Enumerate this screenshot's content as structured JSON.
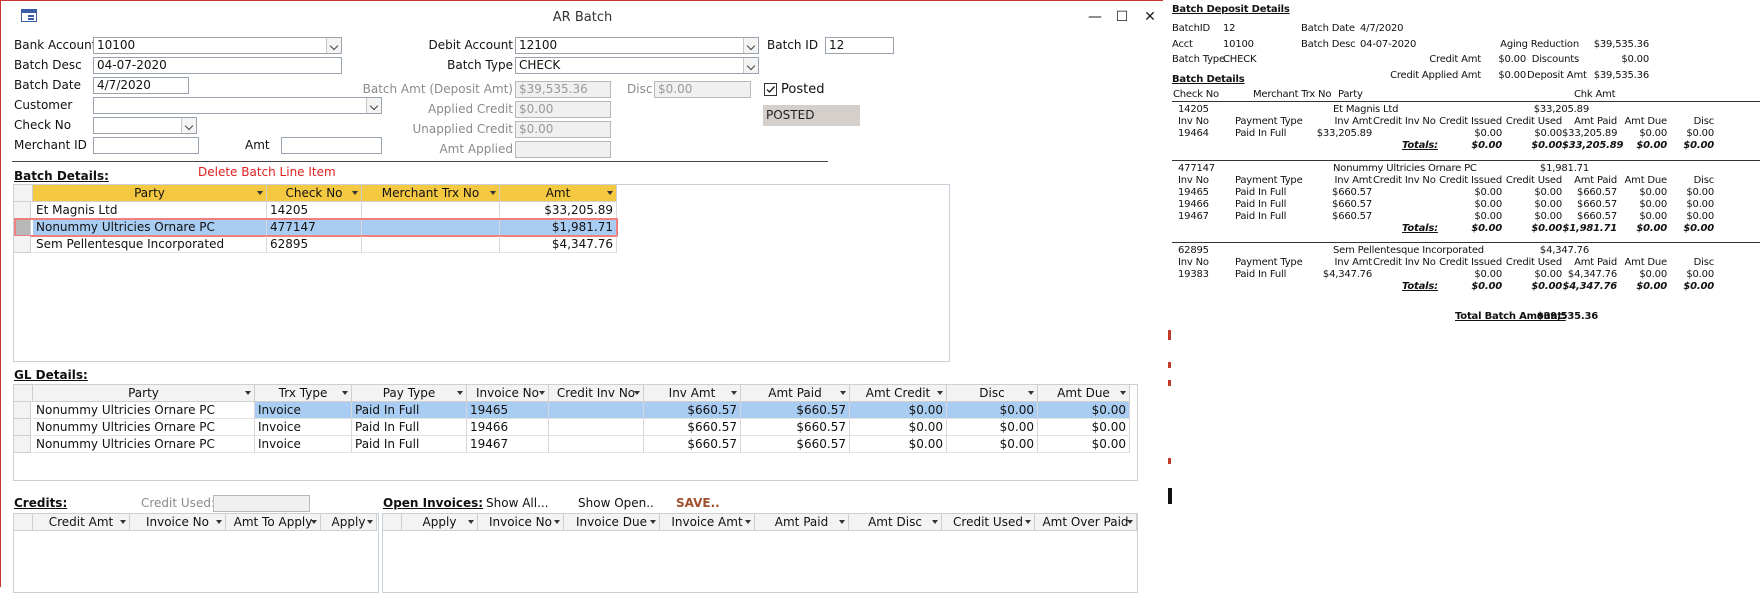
{
  "window": {
    "title": "AR Batch",
    "min": "—",
    "max": "☐",
    "close": "✕"
  },
  "header": {
    "bank_account_label": "Bank Account",
    "bank_account": "10100",
    "batch_desc_label": "Batch Desc",
    "batch_desc": "04-07-2020",
    "batch_date_label": "Batch Date",
    "batch_date": "4/7/2020",
    "customer_label": "Customer",
    "customer": "",
    "check_no_label": "Check No",
    "check_no": "",
    "merchant_id_label": "Merchant ID",
    "merchant_id": "",
    "amt_label": "Amt",
    "amt": "",
    "debit_account_label": "Debit Account",
    "debit_account": "12100",
    "batch_type_label": "Batch Type",
    "batch_type": "CHECK",
    "batch_id_label": "Batch ID",
    "batch_id": "12",
    "batch_amt_label": "Batch Amt (Deposit Amt)",
    "batch_amt": "$39,535.36",
    "disc_label": "Disc",
    "disc": "$0.00",
    "applied_credit_label": "Applied Credit",
    "applied_credit": "$0.00",
    "unapplied_credit_label": "Unapplied Credit",
    "unapplied_credit": "$0.00",
    "amt_applied_label": "Amt Applied",
    "amt_applied": "",
    "posted_label": "Posted",
    "posted_status": "POSTED"
  },
  "batch_details": {
    "label": "Batch Details:",
    "delete_link": "Delete Batch Line Item",
    "columns": [
      "Party",
      "Check No",
      "Merchant Trx No",
      "Amt"
    ],
    "rows": [
      [
        "Et Magnis Ltd",
        "14205",
        "",
        "$33,205.89"
      ],
      [
        "Nonummy Ultricies Ornare PC",
        "477147",
        "",
        "$1,981.71"
      ],
      [
        "Sem Pellentesque Incorporated",
        "62895",
        "",
        "$4,347.76"
      ]
    ]
  },
  "gl_details": {
    "label": "GL Details:",
    "columns": [
      "Party",
      "Trx Type",
      "Pay Type",
      "Invoice No",
      "Credit Inv No",
      "Inv Amt",
      "Amt Paid",
      "Amt Credit",
      "Disc",
      "Amt Due"
    ],
    "rows": [
      [
        "Nonummy Ultricies Ornare PC",
        "Invoice",
        "Paid In Full",
        "19465",
        "",
        "$660.57",
        "$660.57",
        "$0.00",
        "$0.00",
        "$0.00"
      ],
      [
        "Nonummy Ultricies Ornare PC",
        "Invoice",
        "Paid In Full",
        "19466",
        "",
        "$660.57",
        "$660.57",
        "$0.00",
        "$0.00",
        "$0.00"
      ],
      [
        "Nonummy Ultricies Ornare PC",
        "Invoice",
        "Paid In Full",
        "19467",
        "",
        "$660.57",
        "$660.57",
        "$0.00",
        "$0.00",
        "$0.00"
      ]
    ]
  },
  "credits": {
    "label": "Credits:",
    "credit_used_label": "Credit Used:",
    "credit_used": "",
    "columns": [
      "Credit Amt",
      "Invoice No",
      "Amt To Apply",
      "Apply"
    ]
  },
  "open_invoices": {
    "label": "Open Invoices:",
    "show_all": "Show All...",
    "show_open": "Show Open..",
    "save": "SAVE..",
    "columns": [
      "Apply",
      "Invoice No",
      "Invoice Due",
      "Invoice Amt",
      "Amt Paid",
      "Amt Disc",
      "Credit Used",
      "Amt Over Paid"
    ]
  },
  "report": {
    "title": "Batch Deposit Details",
    "batchid_label": "BatchID",
    "batchid": "12",
    "acct_label": "Acct",
    "acct": "10100",
    "batch_type_label": "Batch Type",
    "batch_type": "CHECK",
    "batch_date_label": "Batch Date",
    "batch_date": "4/7/2020",
    "batch_desc_label": "Batch Desc",
    "batch_desc": "04-07-2020",
    "aging_label": "Aging Reduction",
    "aging": "$39,535.36",
    "credit_amt_label": "Credit Amt",
    "credit_amt": "$0.00",
    "discounts_label": "Discounts",
    "discounts": "$0.00",
    "credit_applied_label": "Credit Applied Amt",
    "credit_applied": "$0.00",
    "deposit_amt_label": "Deposit Amt",
    "deposit_amt": "$39,535.36",
    "details_label": "Batch Details",
    "cols": {
      "check_no": "Check No",
      "merchant": "Merchant Trx No",
      "party": "Party",
      "chk_amt": "Chk Amt"
    },
    "sub_cols": [
      "Inv No",
      "Payment Type",
      "Inv Amt",
      "Credit Inv No",
      "Credit Issued",
      "Credit Used",
      "Amt Paid",
      "Amt Due",
      "Disc"
    ],
    "totals_label": "Totals:",
    "groups": [
      {
        "check_no": "14205",
        "party": "Et Magnis Ltd",
        "chk_amt": "$33,205.89",
        "lines": [
          [
            "19464",
            "Paid In Full",
            "$33,205.89",
            "",
            "$0.00",
            "$0.00",
            "$33,205.89",
            "$0.00",
            "$0.00"
          ]
        ],
        "totals": [
          "$0.00",
          "$0.00",
          "$33,205.89",
          "$0.00",
          "$0.00"
        ]
      },
      {
        "check_no": "477147",
        "party": "Nonummy Ultricies Ornare PC",
        "chk_amt": "$1,981.71",
        "lines": [
          [
            "19465",
            "Paid In Full",
            "$660.57",
            "",
            "$0.00",
            "$0.00",
            "$660.57",
            "$0.00",
            "$0.00"
          ],
          [
            "19466",
            "Paid In Full",
            "$660.57",
            "",
            "$0.00",
            "$0.00",
            "$660.57",
            "$0.00",
            "$0.00"
          ],
          [
            "19467",
            "Paid In Full",
            "$660.57",
            "",
            "$0.00",
            "$0.00",
            "$660.57",
            "$0.00",
            "$0.00"
          ]
        ],
        "totals": [
          "$0.00",
          "$0.00",
          "$1,981.71",
          "$0.00",
          "$0.00"
        ]
      },
      {
        "check_no": "62895",
        "party": "Sem Pellentesque Incorporated",
        "chk_amt": "$4,347.76",
        "lines": [
          [
            "19383",
            "Paid In Full",
            "$4,347.76",
            "",
            "$0.00",
            "$0.00",
            "$4,347.76",
            "$0.00",
            "$0.00"
          ]
        ],
        "totals": [
          "$0.00",
          "$0.00",
          "$4,347.76",
          "$0.00",
          "$0.00"
        ]
      }
    ],
    "total_batch_label": "Total Batch Amount:",
    "total_batch": "$39,535.36"
  }
}
